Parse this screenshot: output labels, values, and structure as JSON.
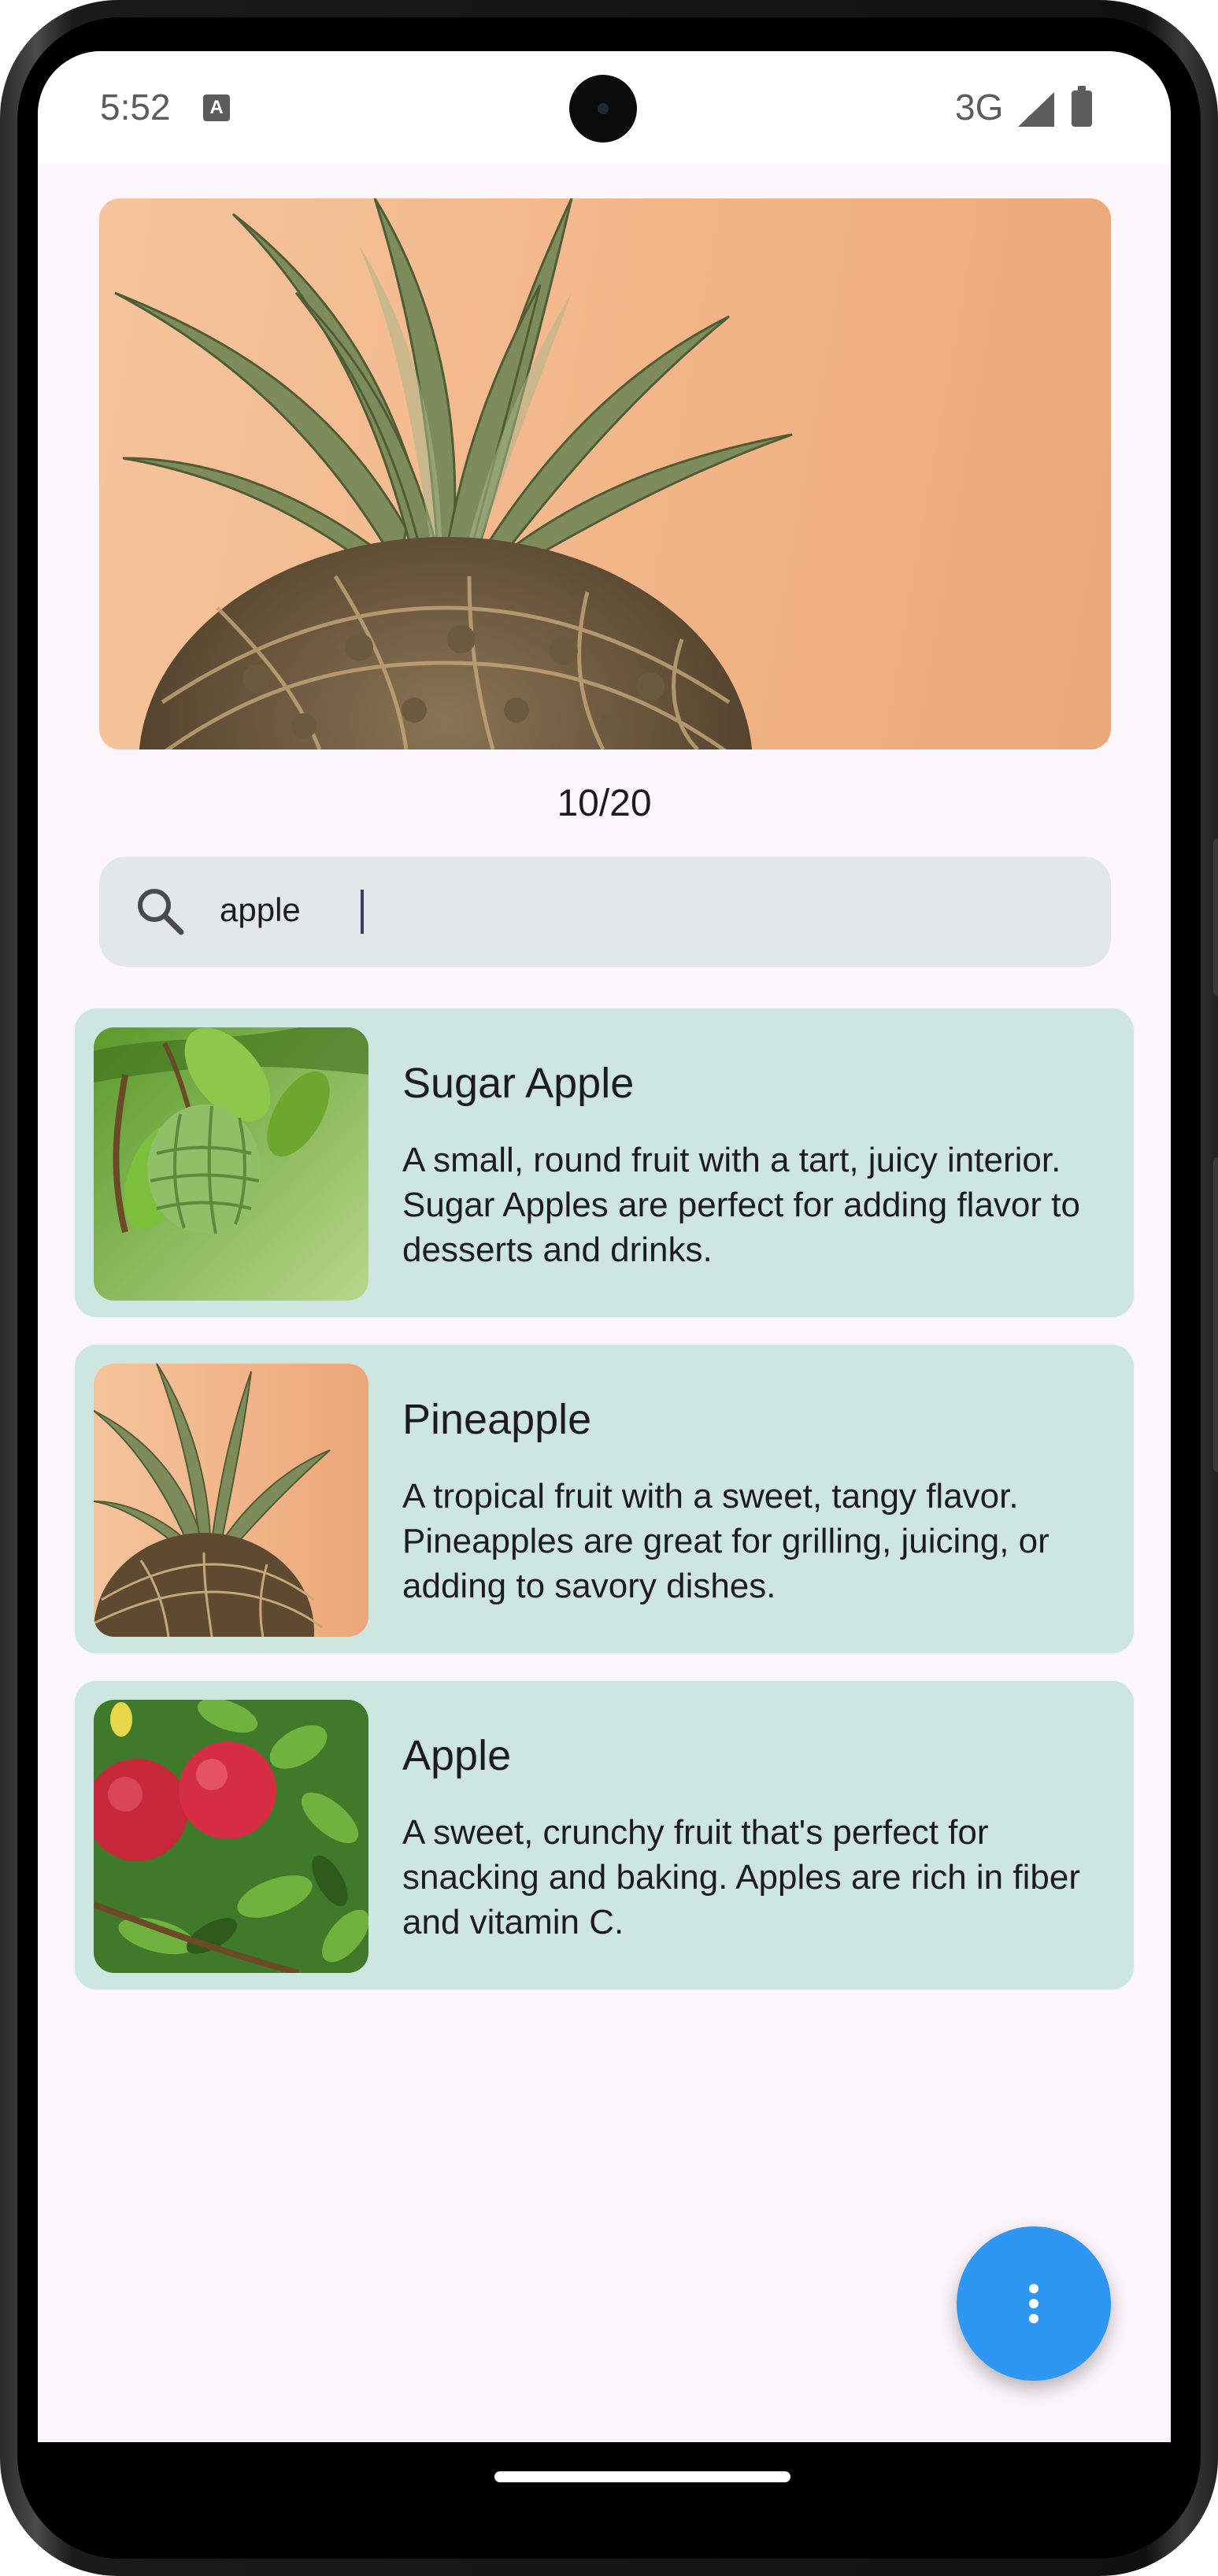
{
  "status_bar": {
    "time": "5:52",
    "notification_icon": "A",
    "network": "3G"
  },
  "hero": {
    "image": "pineapple-photo",
    "counter": "10/20"
  },
  "search": {
    "value": "apple",
    "icon": "search-icon"
  },
  "results": [
    {
      "title": "Sugar Apple",
      "description": "A small, round fruit with a tart, juicy interior. Sugar Apples are perfect for adding flavor to desserts and drinks.",
      "image": "sugar-apple-photo"
    },
    {
      "title": "Pineapple",
      "description": "A tropical fruit with a sweet, tangy flavor. Pineapples are great for grilling, juicing, or adding to savory dishes.",
      "image": "pineapple-photo"
    },
    {
      "title": "Apple",
      "description": "A sweet, crunchy fruit that's perfect for snacking and baking. Apples are rich in fiber and vitamin C.",
      "image": "apple-photo"
    }
  ],
  "fab": {
    "icon": "more-vert-icon"
  },
  "colors": {
    "background": "#fdf6fc",
    "card": "#cde6df",
    "search": "#e2e8e7",
    "fab": "#2d97f1"
  }
}
